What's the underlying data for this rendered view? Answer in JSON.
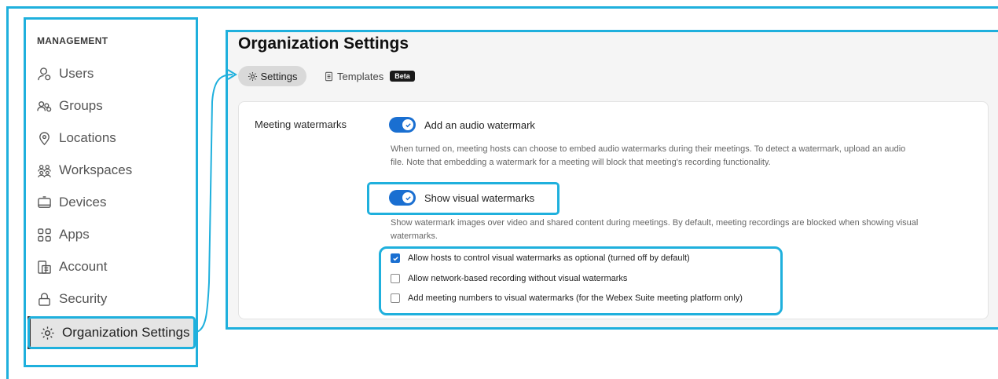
{
  "sidebar": {
    "heading": "MANAGEMENT",
    "items": [
      {
        "label": "Users",
        "icon": "user-icon"
      },
      {
        "label": "Groups",
        "icon": "groups-icon"
      },
      {
        "label": "Locations",
        "icon": "location-pin-icon"
      },
      {
        "label": "Workspaces",
        "icon": "workspaces-icon"
      },
      {
        "label": "Devices",
        "icon": "device-icon"
      },
      {
        "label": "Apps",
        "icon": "apps-grid-icon"
      },
      {
        "label": "Account",
        "icon": "account-icon"
      },
      {
        "label": "Security",
        "icon": "lock-icon"
      },
      {
        "label": "Organization Settings",
        "icon": "gear-icon",
        "active": true
      }
    ]
  },
  "main": {
    "title": "Organization Settings",
    "tabs": [
      {
        "label": "Settings",
        "icon": "gear-icon",
        "selected": true
      },
      {
        "label": "Templates",
        "icon": "document-icon",
        "badge": "Beta"
      }
    ],
    "section": {
      "label": "Meeting watermarks",
      "audio_toggle": {
        "label": "Add an audio watermark",
        "on": true,
        "description_line1": "When turned on, meeting hosts can choose to embed audio watermarks during their meetings. To detect a watermark, upload an audio",
        "description_line2": "file. Note that embedding a watermark for a meeting will block that meeting's recording functionality."
      },
      "visual_toggle": {
        "label": "Show visual watermarks",
        "on": true,
        "description_line1": "Show watermark images over video and shared content during meetings. By default, meeting recordings are blocked when showing visual",
        "description_line2": "watermarks."
      },
      "options": [
        {
          "label": "Allow hosts to control visual watermarks as optional (turned off by default)",
          "checked": true
        },
        {
          "label": "Allow network-based recording without visual watermarks",
          "checked": false
        },
        {
          "label": "Add meeting numbers to visual watermarks (for the Webex Suite meeting platform only)",
          "checked": false
        }
      ]
    }
  },
  "colors": {
    "highlight": "#1fb0dd",
    "accent": "#1a6fd1",
    "active_bg": "#e5e5e5"
  }
}
